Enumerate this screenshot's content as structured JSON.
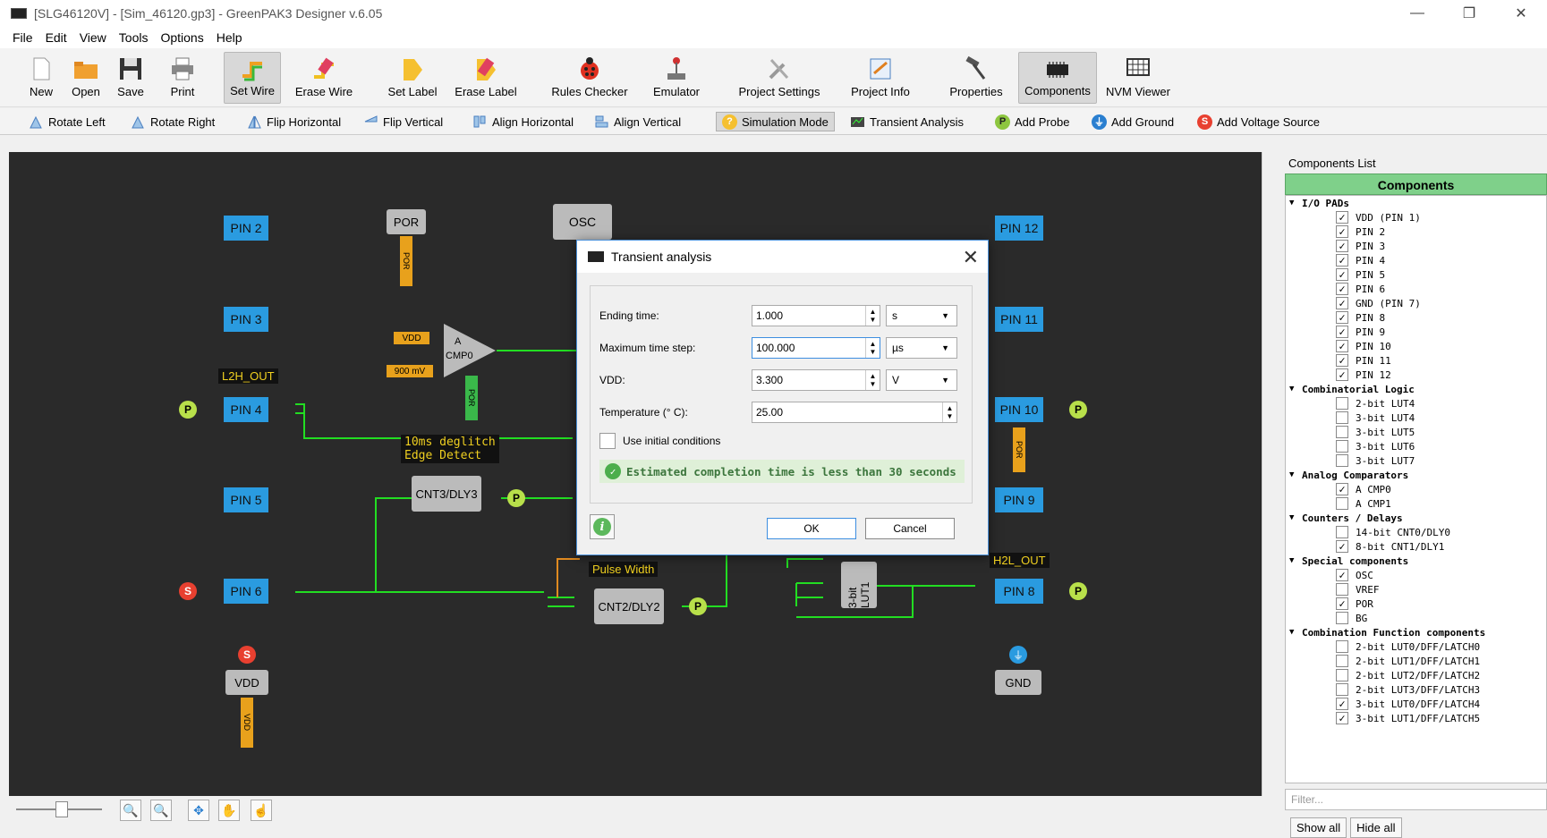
{
  "window": {
    "title": "[SLG46120V] - [Sim_46120.gp3] - GreenPAK3 Designer v.6.05",
    "minimize": "—",
    "restore": "❐",
    "close": "✕"
  },
  "menu": [
    "File",
    "Edit",
    "View",
    "Tools",
    "Options",
    "Help"
  ],
  "toolbar": [
    "New",
    "Open",
    "Save",
    "Print",
    "Set Wire",
    "Erase Wire",
    "Set Label",
    "Erase Label",
    "Rules Checker",
    "Emulator",
    "Project Settings",
    "Project Info",
    "Properties",
    "Components",
    "NVM Viewer"
  ],
  "toolbar2": [
    "Rotate Left",
    "Rotate Right",
    "Flip Horizontal",
    "Flip Vertical",
    "Align Horizontal",
    "Align Vertical",
    "Simulation Mode",
    "Transient Analysis",
    "Add Probe",
    "Add Ground",
    "Add Voltage Source"
  ],
  "schematic": {
    "pins_left": [
      "PIN 2",
      "PIN 3",
      "PIN 4",
      "PIN 5",
      "PIN 6"
    ],
    "pins_right": [
      "PIN 12",
      "PIN 11",
      "PIN 10",
      "PIN 9",
      "PIN 8"
    ],
    "por": "POR",
    "osc": "OSC",
    "acmp": [
      "A",
      "CMP0"
    ],
    "vdd_tag": "VDD",
    "mv_tag": "900 mV",
    "l2h": "L2H_OUT",
    "h2l": "H2L_OUT",
    "deglitch": [
      "10ms deglitch",
      "Edge Detect"
    ],
    "cnt3": "CNT3/DLY3",
    "cnt2": "CNT2/DLY2",
    "pulse": "Pulse Width",
    "lut": "3-bit LUT1",
    "vdd_block": "VDD",
    "gnd_block": "GND",
    "probe": "P",
    "source": "S"
  },
  "dialog": {
    "title": "Transient analysis",
    "fields": [
      {
        "label": "Ending time:",
        "value": "1.000",
        "unit": "s"
      },
      {
        "label": "Maximum time step:",
        "value": "100.000",
        "unit": "µs"
      },
      {
        "label": "VDD:",
        "value": "3.300",
        "unit": "V"
      },
      {
        "label": "Temperature (° C):",
        "value": "25.00",
        "unit": ""
      }
    ],
    "initial_conditions": "Use initial conditions",
    "estimate": "Estimated completion time is less than 30 seconds",
    "ok": "OK",
    "cancel": "Cancel"
  },
  "panel": {
    "header": "Components List",
    "title": "Components",
    "groups": [
      {
        "name": "I/O PADs",
        "items": [
          [
            "VDD (PIN 1)",
            true
          ],
          [
            "PIN 2",
            true
          ],
          [
            "PIN 3",
            true
          ],
          [
            "PIN 4",
            true
          ],
          [
            "PIN 5",
            true
          ],
          [
            "PIN 6",
            true
          ],
          [
            "GND (PIN 7)",
            true
          ],
          [
            "PIN 8",
            true
          ],
          [
            "PIN 9",
            true
          ],
          [
            "PIN 10",
            true
          ],
          [
            "PIN 11",
            true
          ],
          [
            "PIN 12",
            true
          ]
        ]
      },
      {
        "name": "Combinatorial Logic",
        "items": [
          [
            "2-bit LUT4",
            false
          ],
          [
            "3-bit LUT4",
            false
          ],
          [
            "3-bit LUT5",
            false
          ],
          [
            "3-bit LUT6",
            false
          ],
          [
            "3-bit LUT7",
            false
          ]
        ]
      },
      {
        "name": "Analog Comparators",
        "items": [
          [
            "A CMP0",
            true
          ],
          [
            "A CMP1",
            false
          ]
        ]
      },
      {
        "name": "Counters / Delays",
        "items": [
          [
            "14-bit CNT0/DLY0",
            false
          ],
          [
            "8-bit CNT1/DLY1",
            true
          ]
        ]
      },
      {
        "name": "Special components",
        "items": [
          [
            "OSC",
            true
          ],
          [
            "VREF",
            false
          ],
          [
            "POR",
            true
          ],
          [
            "BG",
            false
          ]
        ]
      },
      {
        "name": "Combination Function components",
        "items": [
          [
            "2-bit LUT0/DFF/LATCH0",
            false
          ],
          [
            "2-bit LUT1/DFF/LATCH1",
            false
          ],
          [
            "2-bit LUT2/DFF/LATCH2",
            false
          ],
          [
            "2-bit LUT3/DFF/LATCH3",
            false
          ],
          [
            "3-bit LUT0/DFF/LATCH4",
            true
          ],
          [
            "3-bit LUT1/DFF/LATCH5",
            true
          ]
        ]
      }
    ],
    "filter_placeholder": "Filter...",
    "show_all": "Show all",
    "hide_all": "Hide all"
  },
  "colors": {
    "canvas": "#2a2a2a",
    "pin": "#2a9be0",
    "wire": "#22dd22",
    "block": "#bbbbbb",
    "por": "#e8a11c",
    "probe": "#b8e04a",
    "source": "#e84030",
    "panel_header": "#7fd08a"
  }
}
